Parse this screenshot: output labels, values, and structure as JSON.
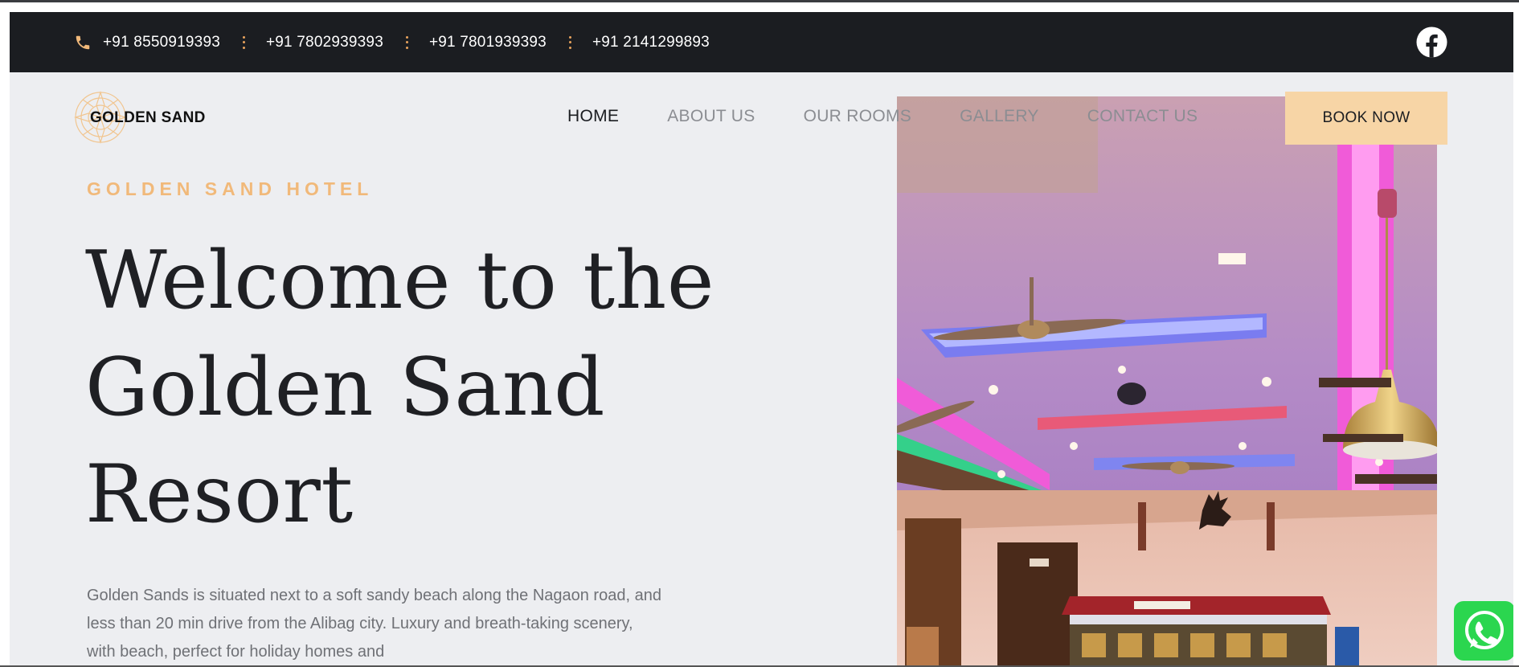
{
  "topbar": {
    "phones": [
      "+91 8550919393",
      "+91 7802939393",
      "+91 7801939393",
      "+91 2141299893"
    ],
    "phone_icon": "phone-icon",
    "social_icon": "facebook-icon"
  },
  "brand": {
    "name": "GOLDEN SAND",
    "logo_icon": "mandala-logo-icon"
  },
  "nav": {
    "items": [
      {
        "label": "HOME",
        "active": true
      },
      {
        "label": "ABOUT US",
        "active": false
      },
      {
        "label": "OUR ROOMS",
        "active": false
      },
      {
        "label": "GALLERY",
        "active": false
      },
      {
        "label": "CONTACT US",
        "active": false
      }
    ],
    "book_label": "BOOK NOW"
  },
  "hero": {
    "eyebrow": "GOLDEN SAND HOTEL",
    "headline_lines": [
      "Welcome to the",
      "Golden Sand",
      "Resort"
    ],
    "description": "Golden Sands is situated next to a soft sandy beach along the Nagaon road, and less than 20 min drive from the Alibag city. Luxury and breath-taking scenery, with beach, perfect for holiday homes and",
    "image_icon": "restaurant-interior-photo",
    "whatsapp_icon": "whatsapp-icon"
  },
  "colors": {
    "topbar_bg": "#1b1d21",
    "accent": "#f1b97a",
    "button_bg": "#f7d5a6",
    "page_bg": "#edeef1"
  }
}
